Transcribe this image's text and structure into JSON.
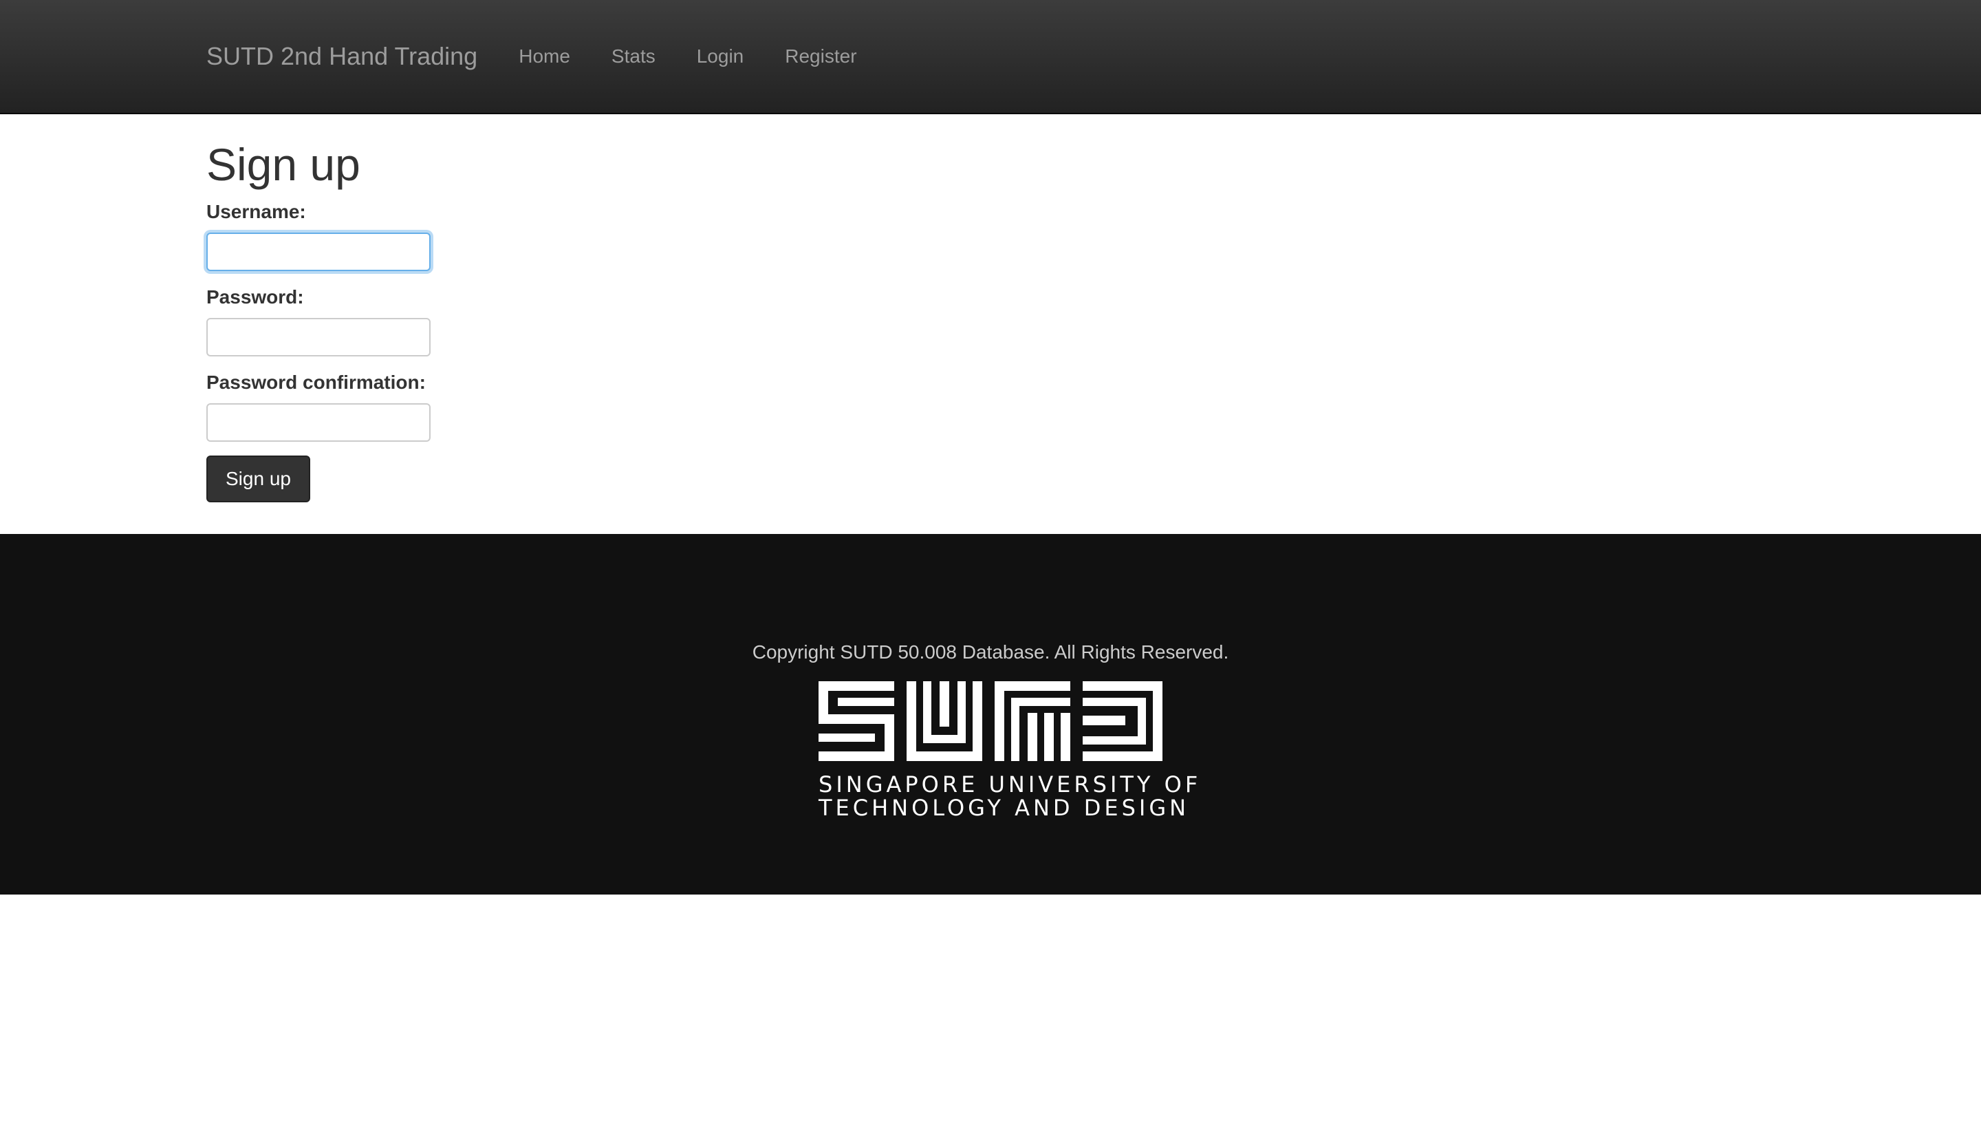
{
  "navbar": {
    "brand": "SUTD 2nd Hand Trading",
    "links": [
      "Home",
      "Stats",
      "Login",
      "Register"
    ]
  },
  "form": {
    "title": "Sign up",
    "fields": [
      {
        "label": "Username:",
        "value": "",
        "focused": true
      },
      {
        "label": "Password:",
        "value": ""
      },
      {
        "label": "Password confirmation:",
        "value": ""
      }
    ],
    "submit_label": "Sign up"
  },
  "footer": {
    "copyright": "Copyright SUTD 50.008 Database. All Rights Reserved.",
    "logo": {
      "name": "sutd-logo",
      "line1": "SINGAPORE UNIVERSITY OF",
      "line2": "TECHNOLOGY AND DESIGN"
    }
  },
  "colors": {
    "navbar_bg": "#222222",
    "nav_text": "#9d9d9d",
    "button_bg": "#333333",
    "footer_bg": "#111111",
    "focus_ring": "#66afe9"
  }
}
